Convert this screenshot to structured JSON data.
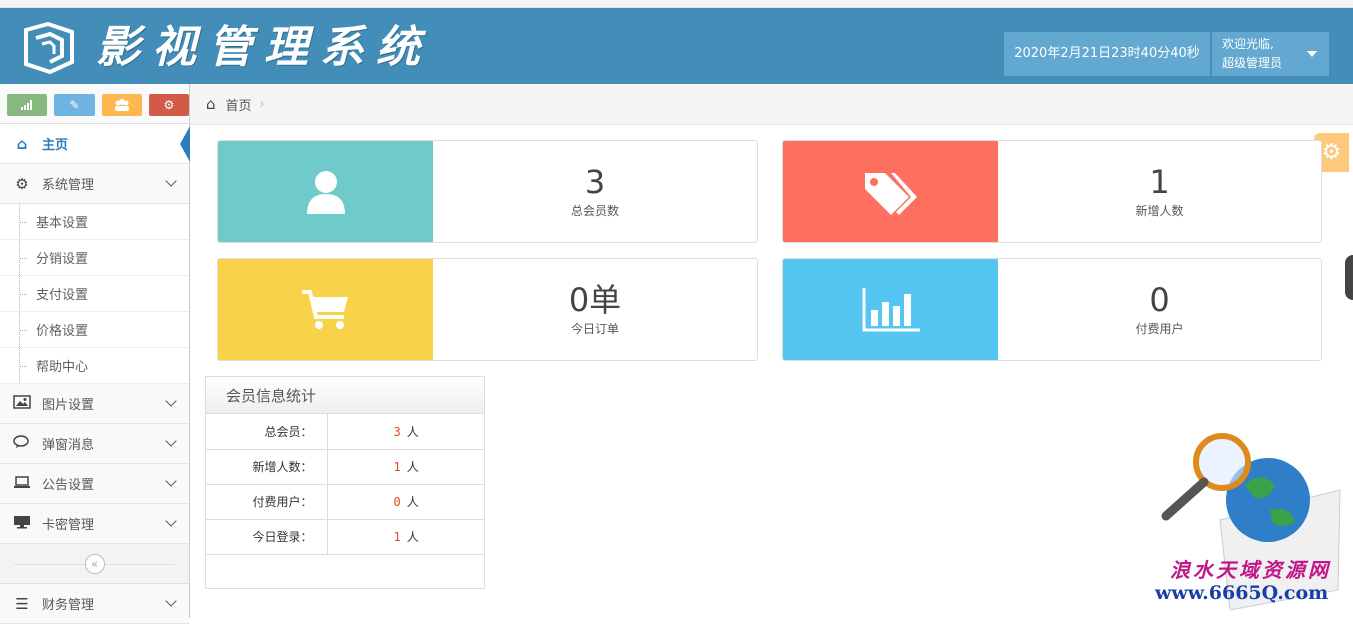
{
  "header": {
    "title_chars": [
      "影",
      "视",
      "管",
      "理",
      "系",
      "统"
    ],
    "datetime": "2020年2月21日23时40分40秒",
    "welcome": "欢迎光临,",
    "username": "超级管理员",
    "bg_color": "#438eb9"
  },
  "sidebar": {
    "shortcuts": [
      {
        "icon": "signal-icon",
        "color": "#87b87f"
      },
      {
        "icon": "pencil-icon",
        "color": "#6fb3e0"
      },
      {
        "icon": "users-icon",
        "color": "#ffb752"
      },
      {
        "icon": "cogs-icon",
        "color": "#d15b47"
      }
    ],
    "home": "主页",
    "system": "系统管理",
    "system_sub": [
      "基本设置",
      "分销设置",
      "支付设置",
      "价格设置",
      "帮助中心"
    ],
    "picture": "图片设置",
    "popup": "弹窗消息",
    "notice": "公告设置",
    "card": "卡密管理",
    "collapse": "«",
    "finance": "财务管理"
  },
  "breadcrumb": {
    "home": "首页",
    "sep": "›"
  },
  "cards": [
    {
      "value": "3",
      "label": "总会员数",
      "color": "#6fcbc9",
      "icon": "user-icon"
    },
    {
      "value": "1",
      "label": "新增人数",
      "color": "#fd6f5e",
      "icon": "tags-icon"
    },
    {
      "value": "0单",
      "label": "今日订单",
      "color": "#f8d249",
      "icon": "cart-icon"
    },
    {
      "value": "0",
      "label": "付费用户",
      "color": "#55c5f2",
      "icon": "bar-chart-icon"
    }
  ],
  "stats": {
    "title": "会员信息统计",
    "unit": "人",
    "rows": [
      {
        "key": "总会员：",
        "value": "3"
      },
      {
        "key": "新增人数：",
        "value": "1"
      },
      {
        "key": "付费用户：",
        "value": "0"
      },
      {
        "key": "今日登录：",
        "value": "1"
      }
    ]
  },
  "watermark": {
    "text": "浪水天域资源网",
    "url": "www.6665Q.com"
  }
}
